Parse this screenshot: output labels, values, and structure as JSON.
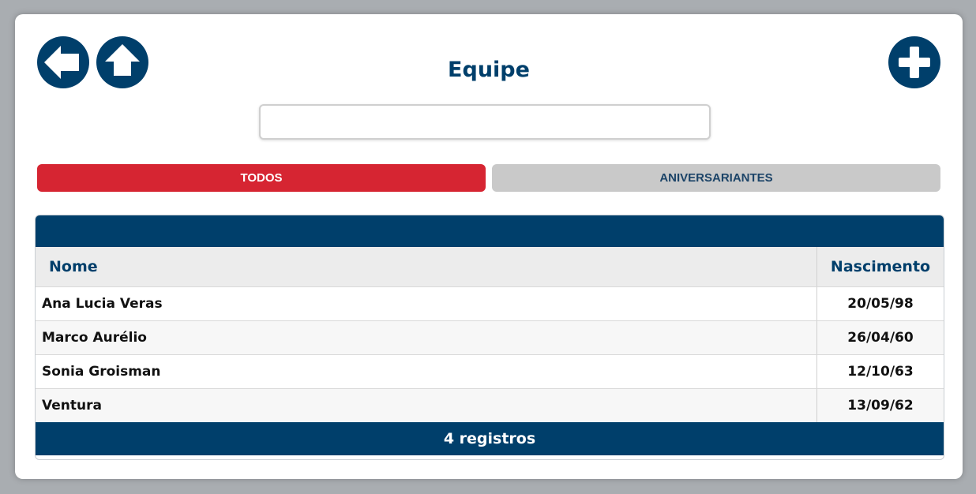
{
  "page": {
    "title": "Equipe"
  },
  "toolbar": {
    "back_icon": "arrow-left-icon",
    "home_icon": "arrow-up-icon",
    "add_icon": "plus-icon"
  },
  "search": {
    "value": "",
    "placeholder": ""
  },
  "tabs": [
    {
      "label": "TODOS",
      "active": true
    },
    {
      "label": "ANIVERSARIANTES",
      "active": false
    }
  ],
  "table": {
    "columns": [
      "Nome",
      "Nascimento"
    ],
    "rows": [
      {
        "name": "Ana Lucia Veras",
        "birth": "20/05/98"
      },
      {
        "name": "Marco Aurélio",
        "birth": "26/04/60"
      },
      {
        "name": "Sonia Groisman",
        "birth": "12/10/63"
      },
      {
        "name": "Ventura",
        "birth": "13/09/62"
      }
    ],
    "footer": "4 registros"
  },
  "colors": {
    "primary": "#003f6b",
    "active_tab": "#d62532",
    "inactive_tab": "#c9c9c9"
  }
}
